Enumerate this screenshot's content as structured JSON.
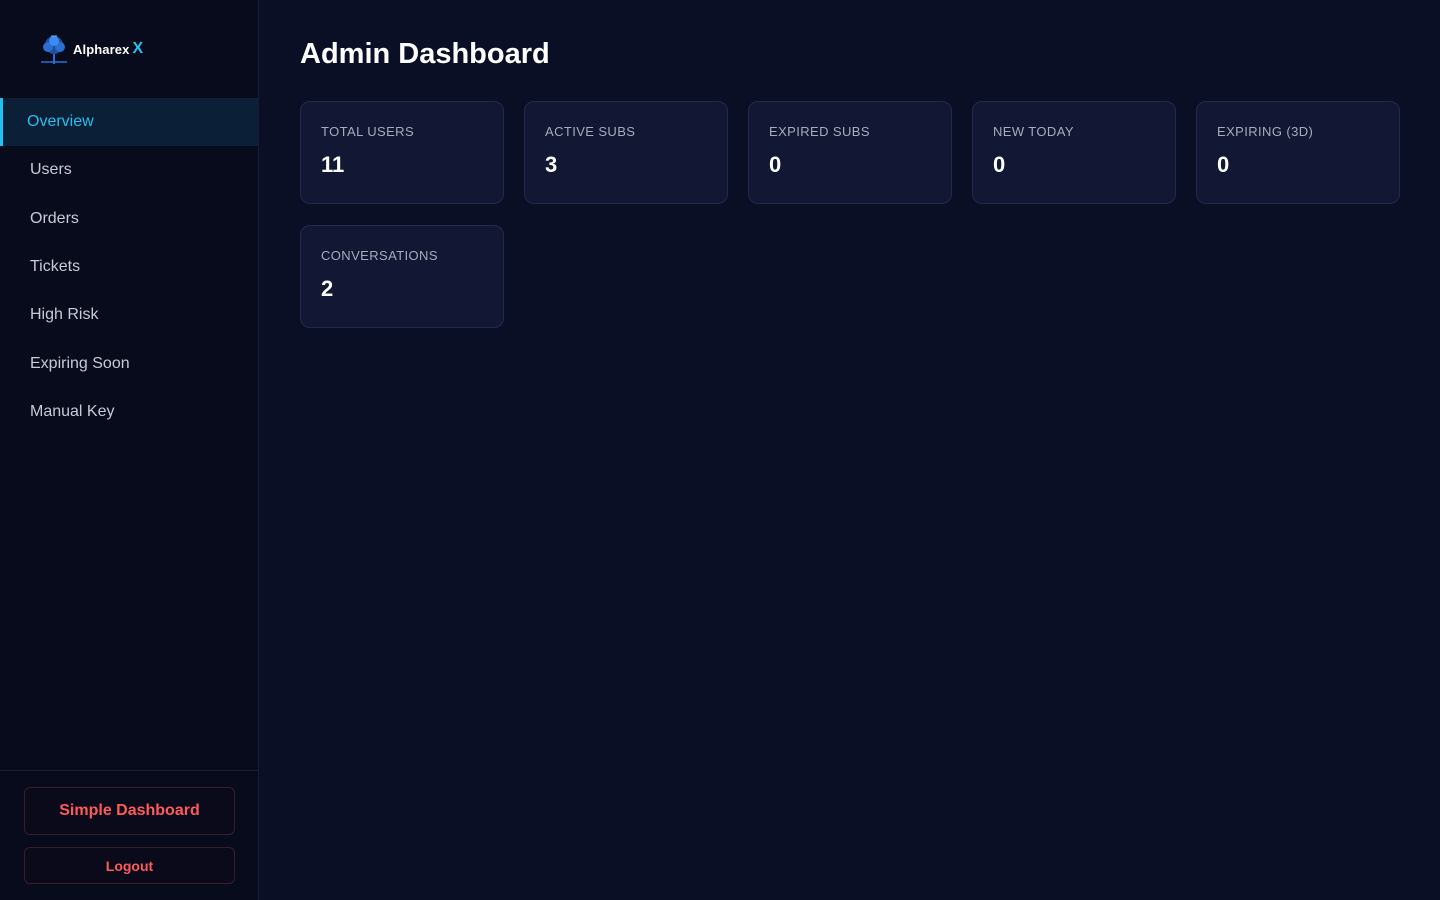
{
  "brand": {
    "name": "Alpharex",
    "accent_letter": "X"
  },
  "sidebar": {
    "items": [
      {
        "label": "Overview",
        "active": true
      },
      {
        "label": "Users"
      },
      {
        "label": "Orders"
      },
      {
        "label": "Tickets"
      },
      {
        "label": "High Risk"
      },
      {
        "label": "Expiring Soon"
      },
      {
        "label": "Manual Key"
      }
    ],
    "simple_dashboard_label": "Simple Dashboard",
    "logout_label": "Logout"
  },
  "main": {
    "title": "Admin Dashboard",
    "cards": [
      {
        "label": "TOTAL USERS",
        "value": "11"
      },
      {
        "label": "ACTIVE SUBS",
        "value": "3"
      },
      {
        "label": "EXPIRED SUBS",
        "value": "0"
      },
      {
        "label": "NEW TODAY",
        "value": "0"
      },
      {
        "label": "EXPIRING (3D)",
        "value": "0"
      },
      {
        "label": "CONVERSATIONS",
        "value": "2"
      }
    ]
  },
  "colors": {
    "background": "#0b0f26",
    "sidebar": "#070b1c",
    "accent": "#26bdf0",
    "danger": "#ff5a5a",
    "card": "#121733"
  }
}
